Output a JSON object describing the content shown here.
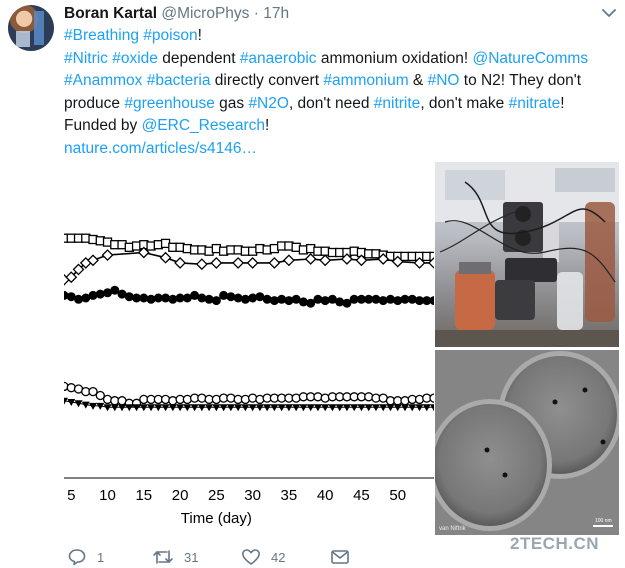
{
  "tweet": {
    "author_name": "Boran Kartal",
    "handle": "@MicroPhys",
    "separator": "·",
    "time": "17h",
    "text_lines": [
      [
        {
          "t": "tag",
          "v": "#Breathing"
        },
        {
          "t": "txt",
          "v": " "
        },
        {
          "t": "tag",
          "v": "#poison"
        },
        {
          "t": "txt",
          "v": "!"
        }
      ],
      [
        {
          "t": "tag",
          "v": "#Nitric"
        },
        {
          "t": "txt",
          "v": " "
        },
        {
          "t": "tag",
          "v": "#oxide"
        },
        {
          "t": "txt",
          "v": " dependent "
        },
        {
          "t": "tag",
          "v": "#anaerobic"
        },
        {
          "t": "txt",
          "v": " ammonium oxidation! "
        },
        {
          "t": "mention",
          "v": "@NatureComms"
        }
      ],
      [
        {
          "t": "tag",
          "v": "#Anammox"
        },
        {
          "t": "txt",
          "v": " "
        },
        {
          "t": "tag",
          "v": "#bacteria"
        },
        {
          "t": "txt",
          "v": " directly convert "
        },
        {
          "t": "tag",
          "v": "#ammonium"
        },
        {
          "t": "txt",
          "v": " & "
        },
        {
          "t": "tag",
          "v": "#NO"
        },
        {
          "t": "txt",
          "v": " to N2! They don't"
        }
      ],
      [
        {
          "t": "txt",
          "v": "produce "
        },
        {
          "t": "tag",
          "v": "#greenhouse"
        },
        {
          "t": "txt",
          "v": " gas "
        },
        {
          "t": "tag",
          "v": "#N2O"
        },
        {
          "t": "txt",
          "v": ", don't need "
        },
        {
          "t": "tag",
          "v": "#nitrite"
        },
        {
          "t": "txt",
          "v": ", don't make "
        },
        {
          "t": "tag",
          "v": "#nitrate"
        },
        {
          "t": "txt",
          "v": "!"
        }
      ],
      [
        {
          "t": "txt",
          "v": "Funded by "
        },
        {
          "t": "mention",
          "v": "@ERC_Research"
        },
        {
          "t": "txt",
          "v": "!"
        }
      ],
      [
        {
          "t": "link",
          "v": "nature.com/articles/s4146…"
        }
      ]
    ]
  },
  "chart_data": {
    "type": "line",
    "xlabel": "Time (day)",
    "ylabel": "",
    "x_ticks": [
      5,
      10,
      15,
      20,
      25,
      30,
      35,
      40,
      45,
      50
    ],
    "xlim": [
      4,
      55
    ],
    "ylim": [
      0,
      10
    ],
    "series": [
      {
        "marker": "square-open",
        "x": [
          4,
          5,
          6,
          7,
          8,
          9,
          10,
          11,
          12,
          13,
          14,
          15,
          16,
          17,
          18,
          19,
          20,
          21,
          22,
          23,
          24,
          25,
          26,
          27,
          28,
          29,
          30,
          31,
          32,
          33,
          34,
          35,
          36,
          37,
          38,
          39,
          40,
          41,
          42,
          43,
          44,
          45,
          46,
          47,
          48,
          49,
          50,
          51,
          52,
          53,
          54,
          55
        ],
        "y": [
          9.3,
          9.3,
          9.3,
          9.3,
          9.25,
          9.2,
          9.15,
          9.05,
          9.05,
          8.95,
          9.0,
          9.05,
          9.0,
          9.05,
          9.1,
          8.95,
          8.95,
          8.9,
          8.85,
          8.85,
          8.8,
          8.9,
          8.8,
          8.85,
          8.85,
          8.8,
          8.8,
          8.9,
          8.85,
          8.9,
          9.0,
          9.0,
          8.95,
          8.85,
          8.9,
          8.8,
          8.8,
          8.75,
          8.75,
          8.75,
          8.8,
          8.75,
          8.7,
          8.7,
          8.65,
          8.6,
          8.6,
          8.6,
          8.6,
          8.6,
          8.6,
          8.6
        ]
      },
      {
        "marker": "diamond-open",
        "x": [
          4,
          5,
          6,
          7,
          8,
          10,
          15,
          18,
          20,
          23,
          25,
          28,
          30,
          33,
          35,
          38,
          40,
          43,
          45,
          48,
          50,
          53,
          55
        ],
        "y": [
          7.7,
          7.8,
          8.1,
          8.35,
          8.45,
          8.65,
          8.75,
          8.55,
          8.35,
          8.3,
          8.35,
          8.35,
          8.35,
          8.35,
          8.45,
          8.5,
          8.45,
          8.5,
          8.45,
          8.5,
          8.4,
          8.35,
          8.35
        ]
      },
      {
        "marker": "circle-filled",
        "x": [
          4,
          5,
          6,
          7,
          8,
          9,
          10,
          11,
          12,
          13,
          14,
          15,
          16,
          17,
          18,
          19,
          20,
          21,
          22,
          23,
          24,
          25,
          26,
          27,
          28,
          29,
          30,
          31,
          32,
          33,
          34,
          35,
          36,
          37,
          38,
          39,
          40,
          41,
          42,
          43,
          44,
          45,
          46,
          47,
          48,
          49,
          50,
          51,
          52,
          53,
          54,
          55
        ],
        "y": [
          7.1,
          7.05,
          6.95,
          7.0,
          7.1,
          7.15,
          7.2,
          7.3,
          7.15,
          7.05,
          7.0,
          7.0,
          6.95,
          7.0,
          7.0,
          6.95,
          7.0,
          7.0,
          7.1,
          7.0,
          6.95,
          6.9,
          7.1,
          7.05,
          7.0,
          6.95,
          7.0,
          7.05,
          6.95,
          6.9,
          6.95,
          6.9,
          6.95,
          6.85,
          6.8,
          6.95,
          6.9,
          6.95,
          6.85,
          6.8,
          6.95,
          6.95,
          6.95,
          6.95,
          6.9,
          6.95,
          6.9,
          6.95,
          6.95,
          6.9,
          6.9,
          6.9
        ]
      },
      {
        "marker": "circle-open",
        "x": [
          4,
          5,
          6,
          7,
          8,
          9,
          10,
          11,
          12,
          13,
          14,
          15,
          16,
          17,
          18,
          19,
          20,
          21,
          22,
          23,
          24,
          25,
          26,
          27,
          28,
          29,
          30,
          31,
          32,
          33,
          34,
          35,
          36,
          37,
          38,
          39,
          40,
          41,
          42,
          43,
          44,
          45,
          46,
          47,
          48,
          49,
          50,
          51,
          52,
          53,
          54,
          55
        ],
        "y": [
          3.6,
          3.55,
          3.5,
          3.4,
          3.4,
          3.25,
          3.1,
          3.05,
          3.05,
          2.95,
          2.95,
          3.1,
          3.1,
          3.1,
          3.1,
          3.05,
          3.1,
          3.1,
          3.15,
          3.15,
          3.1,
          3.1,
          3.15,
          3.15,
          3.1,
          3.1,
          3.15,
          3.1,
          3.15,
          3.15,
          3.15,
          3.15,
          3.15,
          3.2,
          3.2,
          3.2,
          3.15,
          3.2,
          3.2,
          3.2,
          3.2,
          3.2,
          3.2,
          3.15,
          3.15,
          3.05,
          3.05,
          3.05,
          3.1,
          3.1,
          3.15,
          3.15
        ]
      },
      {
        "marker": "triangle-filled",
        "x": [
          4,
          5,
          6,
          7,
          8,
          9,
          10,
          11,
          12,
          13,
          14,
          15,
          16,
          17,
          18,
          19,
          20,
          21,
          22,
          23,
          24,
          25,
          26,
          27,
          28,
          29,
          30,
          31,
          32,
          33,
          34,
          35,
          36,
          37,
          38,
          39,
          40,
          41,
          42,
          43,
          44,
          45,
          46,
          47,
          48,
          49,
          50,
          51,
          52,
          53,
          54,
          55
        ],
        "y": [
          3.05,
          3.0,
          2.95,
          2.9,
          2.85,
          2.85,
          2.8,
          2.8,
          2.8,
          2.8,
          2.8,
          2.8,
          2.8,
          2.8,
          2.8,
          2.8,
          2.8,
          2.8,
          2.8,
          2.8,
          2.8,
          2.8,
          2.8,
          2.8,
          2.8,
          2.8,
          2.8,
          2.8,
          2.8,
          2.8,
          2.8,
          2.8,
          2.8,
          2.8,
          2.8,
          2.8,
          2.8,
          2.8,
          2.8,
          2.8,
          2.8,
          2.8,
          2.8,
          2.8,
          2.8,
          2.8,
          2.8,
          2.8,
          2.8,
          2.8,
          2.8,
          2.8
        ]
      }
    ]
  },
  "media": {
    "photo_bottom_caption": "van Niftrik",
    "photo_bottom_scale": "100 nm"
  },
  "actions": {
    "reply_count": "1",
    "retweet_count": "31",
    "like_count": "42"
  },
  "watermark": "2TECH.CN",
  "colors": {
    "link": "#1da1f2",
    "muted": "#657786",
    "text": "#14171a"
  },
  "icons": {
    "reply": "speech-bubble-icon",
    "retweet": "retweet-arrows-icon",
    "like": "heart-icon",
    "dm": "envelope-icon",
    "caret": "chevron-down-icon"
  }
}
